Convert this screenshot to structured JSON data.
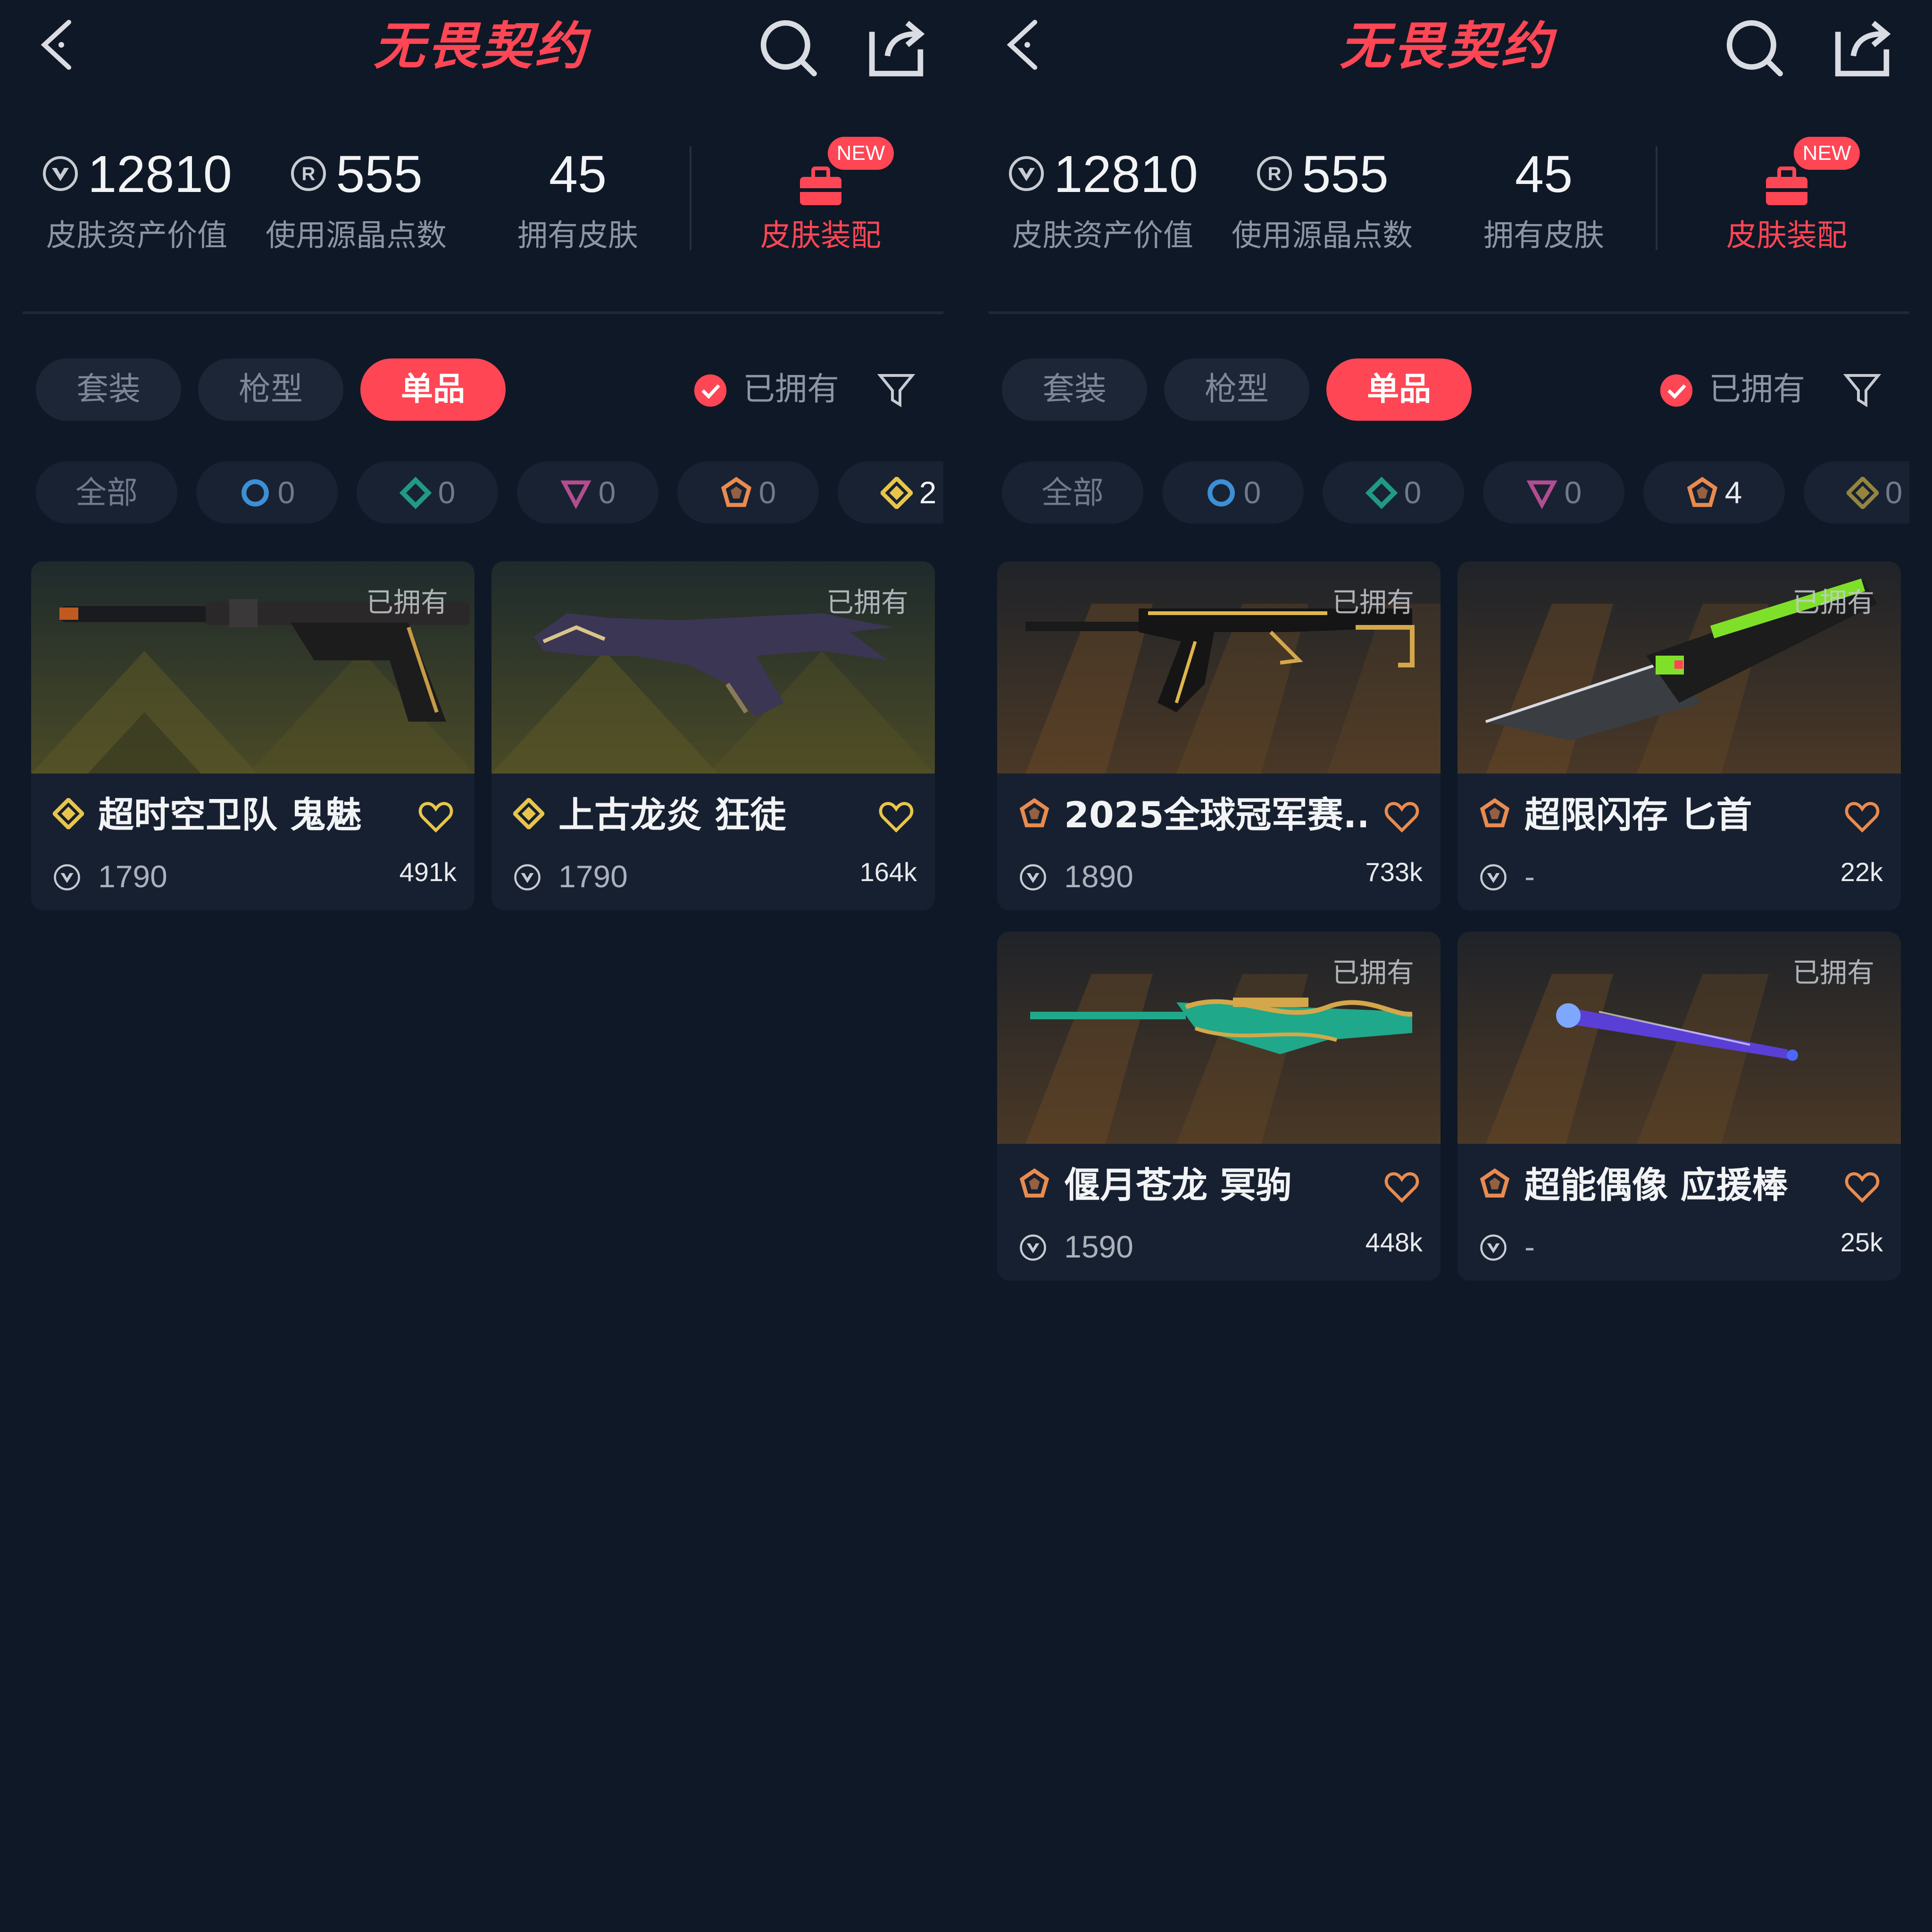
{
  "colors": {
    "background": "#0f1826",
    "accent": "#ff4655",
    "card": "#182130",
    "muted_text": "#8c95a5",
    "gold_tier": "#e8c54a",
    "orange_tier": "#e98b4f"
  },
  "panels": [
    {
      "header": {
        "logo": "无畏契约",
        "icons": [
          "back-icon",
          "search-icon",
          "share-icon"
        ]
      },
      "stats": [
        {
          "value": "12810",
          "label": "皮肤资产价值",
          "icon": "vp-coin-icon"
        },
        {
          "value": "555",
          "label": "使用源晶点数",
          "icon": "radianite-icon"
        },
        {
          "value": "45",
          "label": "拥有皮肤"
        }
      ],
      "equip": {
        "label": "皮肤装配",
        "badge": "NEW",
        "icon": "briefcase-icon"
      },
      "tabs": [
        {
          "label": "套装",
          "active": false
        },
        {
          "label": "枪型",
          "active": false
        },
        {
          "label": "单品",
          "active": true
        }
      ],
      "owned_filter": {
        "label": "已拥有",
        "checked": true
      },
      "tiers": [
        {
          "label": "全部"
        },
        {
          "count": "0",
          "icon": "select-tier-icon"
        },
        {
          "count": "0",
          "icon": "deluxe-tier-icon"
        },
        {
          "count": "0",
          "icon": "premium-tier-icon"
        },
        {
          "count": "0",
          "icon": "ultra-tier-icon"
        },
        {
          "count": "2",
          "icon": "exclusive-tier-icon"
        }
      ],
      "cards": [
        {
          "tag": "已拥有",
          "name": "超时空卫队 鬼魅",
          "price": "1790",
          "likes": "491k",
          "tier_icon": "exclusive-tier-icon",
          "weapon_icon": "pistol-icon"
        },
        {
          "tag": "已拥有",
          "name": "上古龙炎 狂徒",
          "price": "1790",
          "likes": "164k",
          "tier_icon": "exclusive-tier-icon",
          "weapon_icon": "dragon-rifle-icon"
        }
      ]
    },
    {
      "header": {
        "logo": "无畏契约",
        "icons": [
          "back-icon",
          "search-icon",
          "share-icon"
        ]
      },
      "stats": [
        {
          "value": "12810",
          "label": "皮肤资产价值",
          "icon": "vp-coin-icon"
        },
        {
          "value": "555",
          "label": "使用源晶点数",
          "icon": "radianite-icon"
        },
        {
          "value": "45",
          "label": "拥有皮肤"
        }
      ],
      "equip": {
        "label": "皮肤装配",
        "badge": "NEW",
        "icon": "briefcase-icon"
      },
      "tabs": [
        {
          "label": "套装",
          "active": false
        },
        {
          "label": "枪型",
          "active": false
        },
        {
          "label": "单品",
          "active": true
        }
      ],
      "owned_filter": {
        "label": "已拥有",
        "checked": true
      },
      "tiers": [
        {
          "label": "全部"
        },
        {
          "count": "0",
          "icon": "select-tier-icon"
        },
        {
          "count": "0",
          "icon": "deluxe-tier-icon"
        },
        {
          "count": "0",
          "icon": "premium-tier-icon"
        },
        {
          "count": "4",
          "icon": "ultra-tier-icon"
        },
        {
          "count": "0",
          "icon": "exclusive-tier-icon"
        }
      ],
      "cards": [
        {
          "tag": "已拥有",
          "name": "2025全球冠军赛...",
          "price": "1890",
          "likes": "733k",
          "tier_icon": "ultra-tier-icon",
          "weapon_icon": "rifle-icon"
        },
        {
          "tag": "已拥有",
          "name": "超限闪存 匕首",
          "price": "-",
          "likes": "22k",
          "tier_icon": "ultra-tier-icon",
          "weapon_icon": "knife-icon"
        },
        {
          "tag": "已拥有",
          "name": "偃月苍龙 冥驹",
          "price": "1590",
          "likes": "448k",
          "tier_icon": "ultra-tier-icon",
          "weapon_icon": "sniper-icon"
        },
        {
          "tag": "已拥有",
          "name": "超能偶像 应援棒",
          "price": "-",
          "likes": "25k",
          "tier_icon": "ultra-tier-icon",
          "weapon_icon": "glowstick-icon"
        }
      ]
    }
  ]
}
